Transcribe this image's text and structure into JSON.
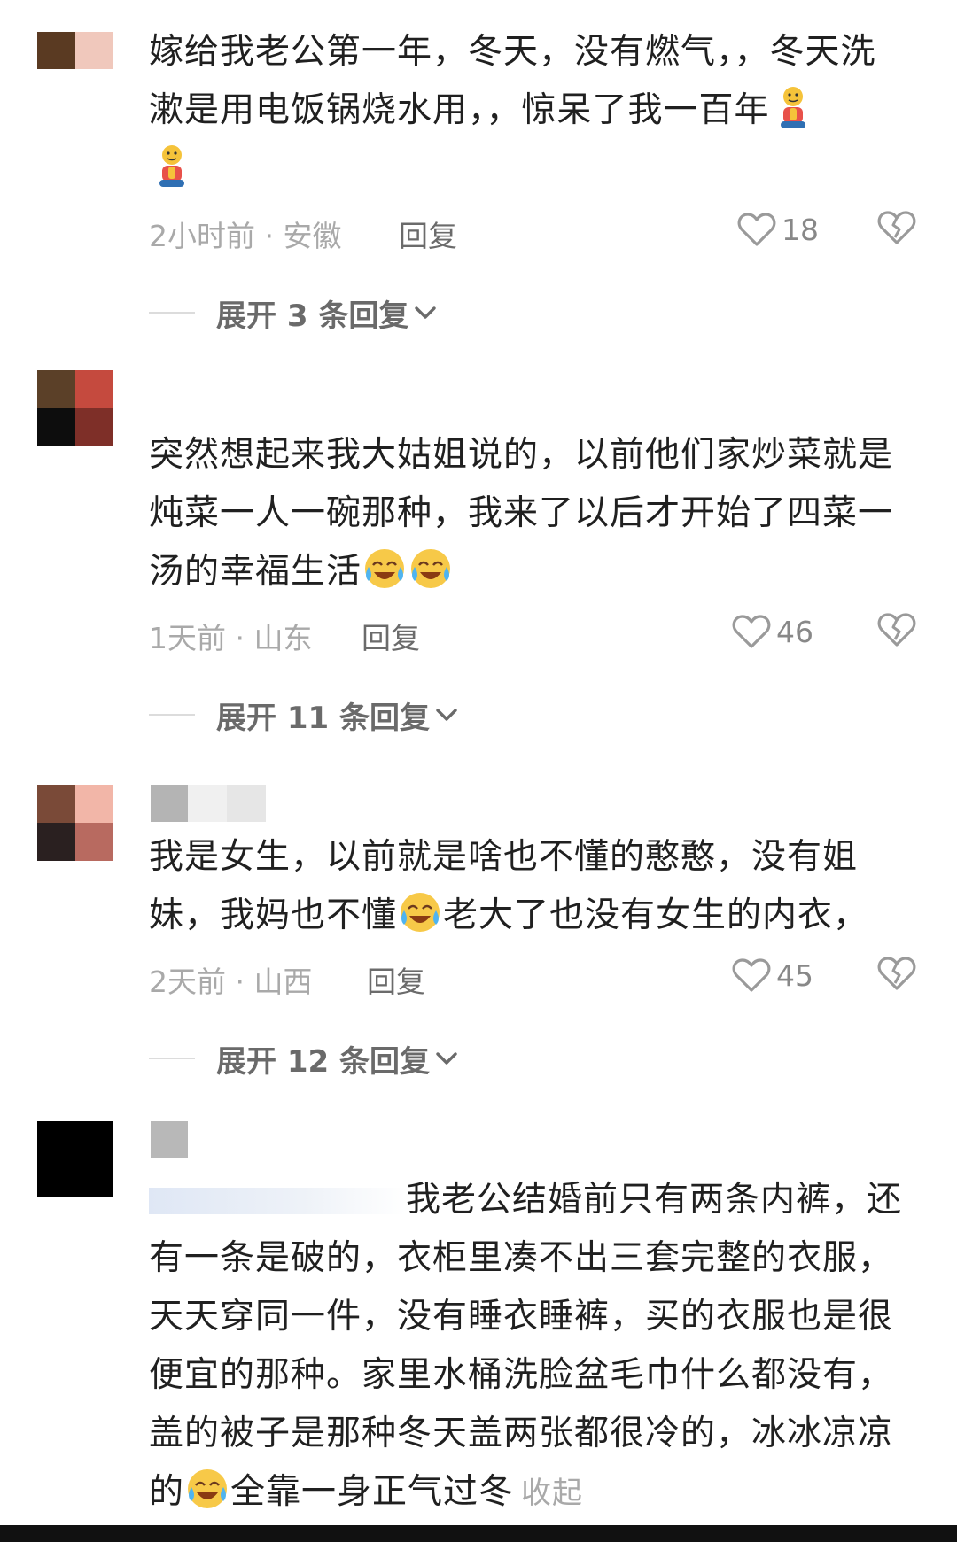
{
  "comments": [
    {
      "text": "嫁给我老公第一年，冬天，没有燃气，，冬天洗漱是用电饭锅烧水用，，惊呆了我一百年",
      "time_location": "2小时前 · 安徽",
      "reply_label": "回复",
      "like_count": "18",
      "expand_label": "展开 3 条回复"
    },
    {
      "text": "突然想起来我大姑姐说的，以前他们家炒菜就是炖菜一人一碗那种，我来了以后才开始了四菜一汤的幸福生活",
      "time_location": "1天前 · 山东",
      "reply_label": "回复",
      "like_count": "46",
      "expand_label": "展开 11 条回复"
    },
    {
      "text_a": "我是女生，以前就是啥也不懂的憨憨，没有姐妹，我妈也不懂",
      "text_b": "老大了也没有女生的内衣，",
      "time_location": "2天前 · 山西",
      "reply_label": "回复",
      "like_count": "45",
      "expand_label": "展开 12 条回复"
    },
    {
      "text_a": "我老公结婚前只有两条内裤，还有一条是破的，衣柜里凑不出三套完整的衣服，天天穿同一件，没有睡衣睡裤，买的衣服也是很便宜的那种。家里水桶洗脸盆毛巾什么都没有，盖的被子是那种冬天盖两张都很冷的，冰冰凉凉的",
      "text_b": "全靠一身正气过冬",
      "collapse_label": "收起"
    }
  ],
  "icons": {
    "like": "heart-outline-icon",
    "dislike": "broken-heart-icon",
    "expand": "chevron-down-icon",
    "emoji_pray": "pray-emoji-icon",
    "emoji_cry": "tears-of-joy-emoji-icon"
  },
  "colors": {
    "text": "#202020",
    "meta": "#a9a9a9",
    "reply": "#6b6b6b",
    "icon": "#9a9a9a"
  }
}
